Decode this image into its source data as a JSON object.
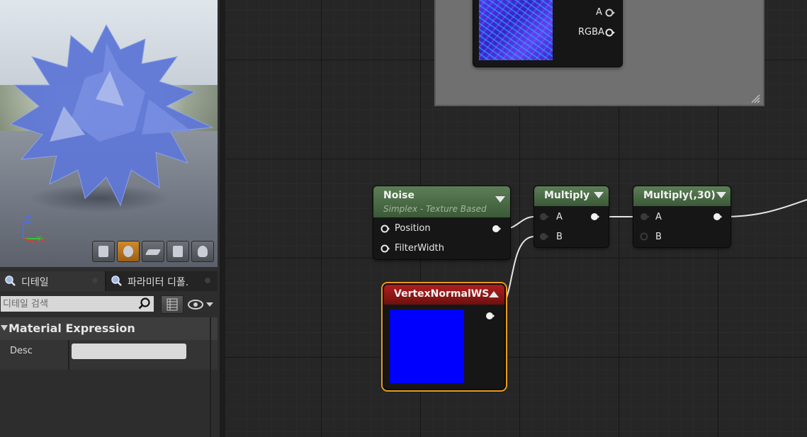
{
  "viewport": {
    "axis_labels": [
      "Z",
      "X",
      "Y"
    ],
    "toolbar": [
      "cylinder-preview",
      "sphere-preview",
      "plane-preview",
      "cube-preview",
      "teapot-preview"
    ]
  },
  "panel": {
    "tabs": [
      {
        "label": "디테일",
        "active": true
      },
      {
        "label": "파라미터 디폴.",
        "active": false
      }
    ],
    "search_placeholder": "디테일 검색",
    "section": {
      "title": "Material Expression"
    },
    "properties": [
      {
        "label": "Desc",
        "value": ""
      }
    ]
  },
  "graph": {
    "texture_node": {
      "pins": [
        "A",
        "RGBA"
      ]
    },
    "noise_node": {
      "title": "Noise",
      "subtitle": "Simplex - Texture Based",
      "inputs": [
        "Position",
        "FilterWidth"
      ]
    },
    "multiply_node": {
      "title": "Multiply",
      "inputs": [
        "A",
        "B"
      ]
    },
    "multiply30_node": {
      "title": "Multiply(,30)",
      "inputs": [
        "A",
        "B"
      ]
    },
    "vertex_normal_node": {
      "title": "VertexNormalWS",
      "preview_color": "#0000ff",
      "selected": true
    }
  },
  "colors": {
    "accent": "#e99a1e",
    "math_header": "#4f6f49",
    "input_header": "#9c1a1a"
  }
}
